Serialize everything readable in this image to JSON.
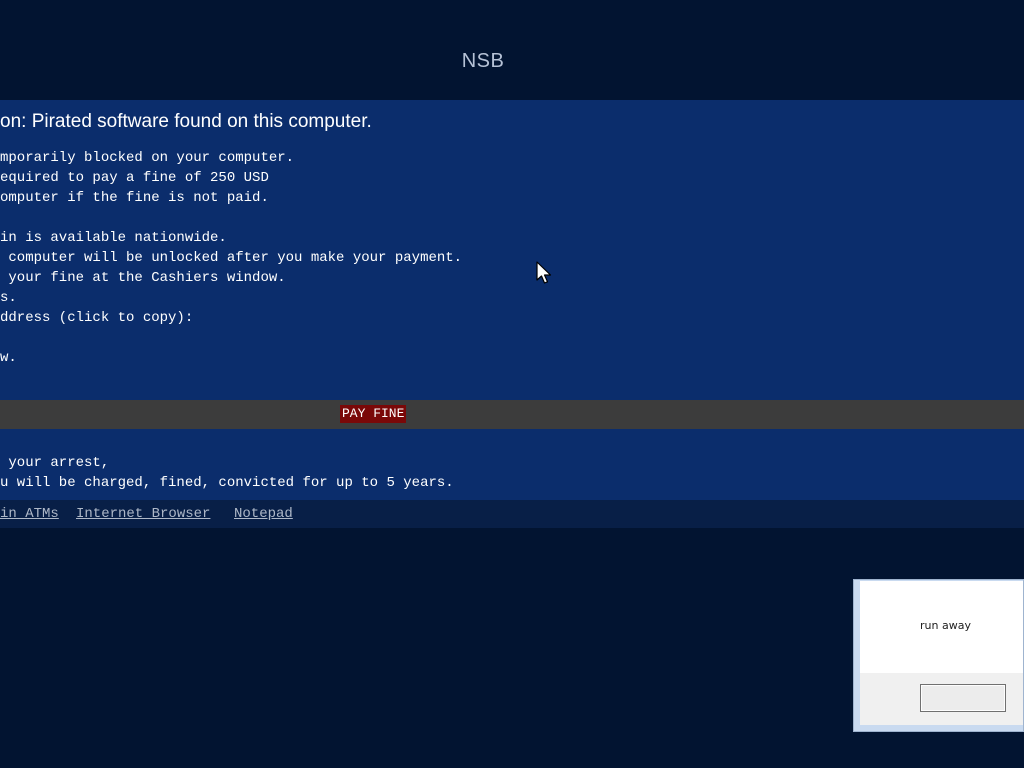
{
  "header": {
    "title": "NSB"
  },
  "notice": {
    "heading": "on: Pirated software found on this computer.",
    "lines": [
      "mporarily blocked on your computer.",
      "equired to pay a fine of 250 USD",
      "omputer if the fine is not paid.",
      "",
      "in is available nationwide.",
      " computer will be unlocked after you make your payment.",
      " your fine at the Cashiers window.",
      "s.",
      "ddress (click to copy):",
      "",
      "w."
    ]
  },
  "pay_bar": {
    "button_label": "PAY FINE",
    "button_bg": "#7a0808"
  },
  "warning": {
    "lines": [
      " your arrest,",
      "u will be charged, fined, convicted for up to 5 years."
    ]
  },
  "links": {
    "items": [
      "in ATMs",
      "Internet Browser",
      "Notepad"
    ]
  },
  "dialog": {
    "message": "run away",
    "ok_label": ""
  },
  "colors": {
    "background": "#021431",
    "panel": "#0b2d6c",
    "pay_bar": "#3c3c3c",
    "links_bar": "#081f47"
  }
}
